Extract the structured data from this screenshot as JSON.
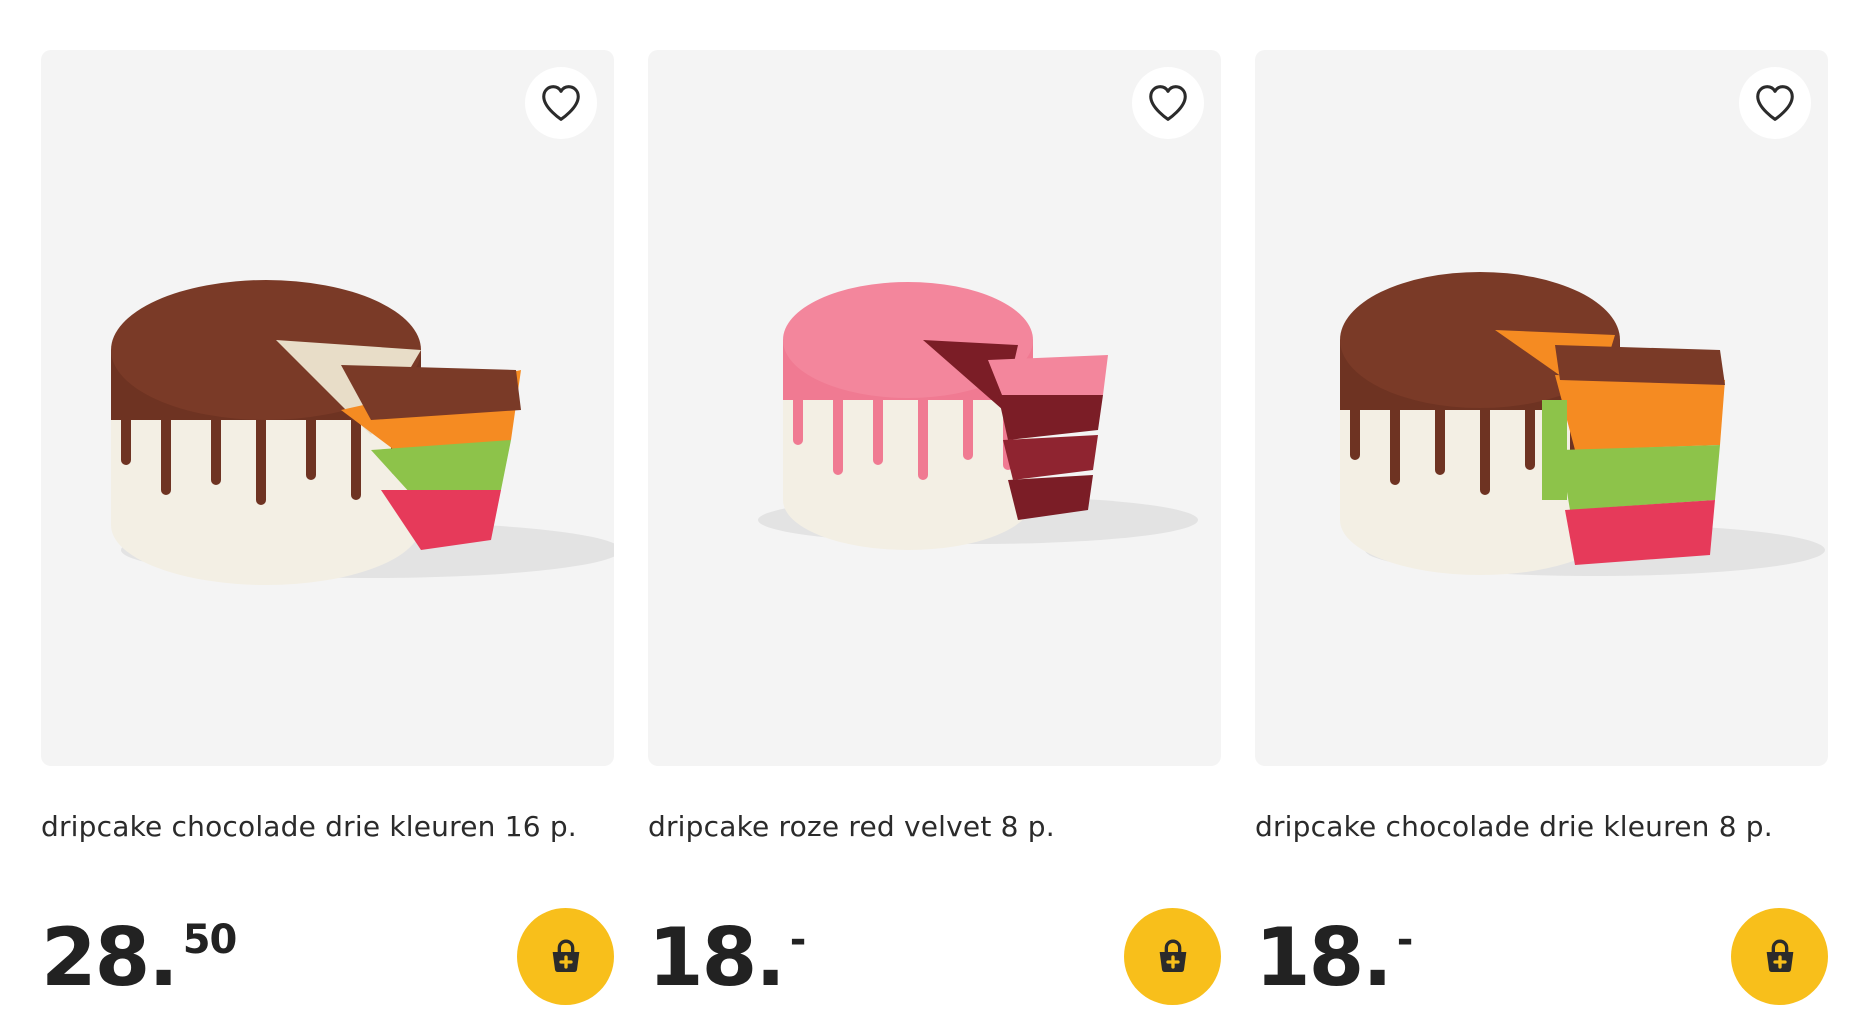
{
  "products": [
    {
      "title": "dripcake chocolade drie kleuren 16 p.",
      "price_main": "28.",
      "price_decimals": "50",
      "image": "chocolate-drip-rainbow-cake"
    },
    {
      "title": "dripcake roze red velvet 8 p.",
      "price_main": "18.",
      "price_decimals": "-",
      "image": "pink-red-velvet-drip-cake"
    },
    {
      "title": "dripcake chocolade drie kleuren 8 p.",
      "price_main": "18.",
      "price_decimals": "-",
      "image": "chocolate-drip-rainbow-cake-small"
    }
  ],
  "icons": {
    "favorite": "heart-outline-icon",
    "add_to_cart": "basket-plus-icon"
  },
  "colors": {
    "accent": "#f8bf1b",
    "card_bg": "#f4f4f4",
    "text": "#2b2b2b"
  }
}
